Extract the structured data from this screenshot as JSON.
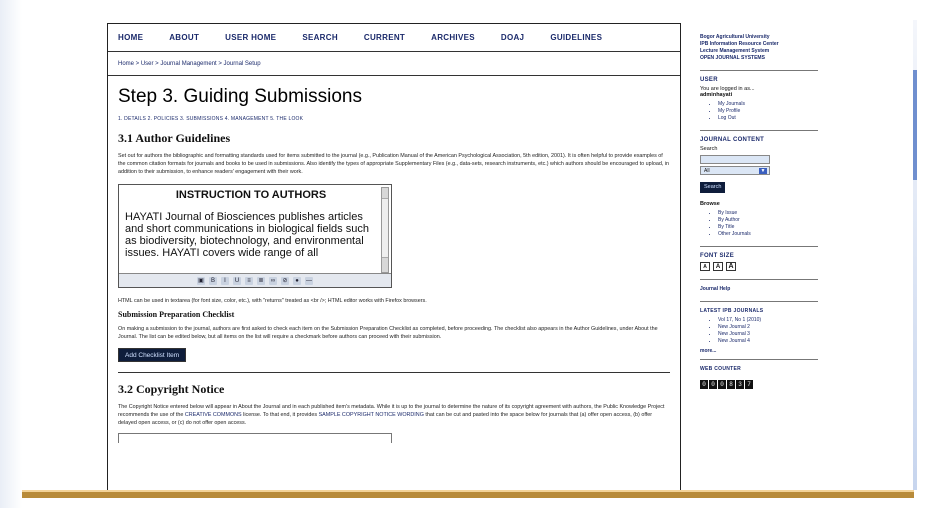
{
  "nav": {
    "items": [
      "HOME",
      "ABOUT",
      "USER HOME",
      "SEARCH",
      "CURRENT",
      "ARCHIVES",
      "DOAJ",
      "GUIDELINES"
    ]
  },
  "breadcrumb": "Home > User > Journal Management > Journal Setup",
  "page": {
    "title": "Step 3. Guiding Submissions",
    "steps": "1. DETAILS  2. POLICIES  3. SUBMISSIONS  4. MANAGEMENT  5. THE LOOK"
  },
  "author_guidelines": {
    "title": "3.1 Author Guidelines",
    "description": "Set out for authors the bibliographic and formatting standards used for items submitted to the journal (e.g., Publication Manual of the American Psychological Association, 5th edition, 2001). It is often helpful to provide examples of the common citation formats for journals and books to be used in submissions. Also identify the types of appropriate Supplementary Files (e.g., data-sets, research instruments, etc.) which authors should be encouraged to upload, in addition to their submission, to enhance readers' engagement with their work.",
    "editor_heading": "INSTRUCTION TO AUTHORS",
    "editor_body": "HAYATI Journal of Biosciences publishes articles and short communications in biological fields such as biodiversity, biotechnology, and environmental issues. HAYATI covers wide range of all",
    "html_note": "HTML can be used in textarea (for font size, color, etc.), with \"returns\" treated as <br />; HTML editor works with Firefox browsers."
  },
  "checklist": {
    "title": "Submission Preparation Checklist",
    "description": "On making a submission to the journal, authors are first asked to check each item on the Submission Preparation Checklist as completed, before proceeding. The checklist also appears in the Author Guidelines, under About the Journal. The list can be edited below, but all items on the list will require a checkmark before authors can proceed with their submission.",
    "button": "Add Checklist Item"
  },
  "copyright": {
    "title": "3.2 Copyright Notice",
    "text_a": "The Copyright Notice entered below will appear in About the Journal and in each published item's metadata. While it is up to the journal to determine the nature of its copyright agreement with authors, the Public Knowledge Project recommends the use of the ",
    "link_cc": "CREATIVE COMMONS",
    "text_b": " license. To that end, it provides ",
    "link_sample": "SAMPLE COPYRIGHT NOTICE WORDING",
    "text_c": " that can be cut and pasted into the space below for journals that (a) offer open access, (b) offer delayed open access, or (c) do not offer open access."
  },
  "sidebar": {
    "institution": [
      "Bogor Agricultural University",
      "IPB Information Resource Center",
      "Lecture Management System",
      "OPEN JOURNAL SYSTEMS"
    ],
    "user_head": "USER",
    "logged_as": "You are logged in as...",
    "username": "adminhayati",
    "user_links": [
      "My Journals",
      "My Profile",
      "Log Out"
    ],
    "journal_content_head": "JOURNAL CONTENT",
    "search_label": "Search",
    "search_select": "All",
    "search_button": "Search",
    "browse_label": "Browse",
    "browse_links": [
      "By Issue",
      "By Author",
      "By Title",
      "Other Journals"
    ],
    "font_size_head": "FONT SIZE",
    "journal_help": "Journal Help",
    "latest_head": "LATEST IPB JOURNALS",
    "latest_links": [
      "Vol 17, No 1 (2010)",
      "New Journal 2",
      "New Journal 3",
      "New Journal 4"
    ],
    "more": "more...",
    "counter_head": "WEB COUNTER",
    "counter_digits": [
      "0",
      "0",
      "0",
      "8",
      "3",
      "7"
    ]
  }
}
